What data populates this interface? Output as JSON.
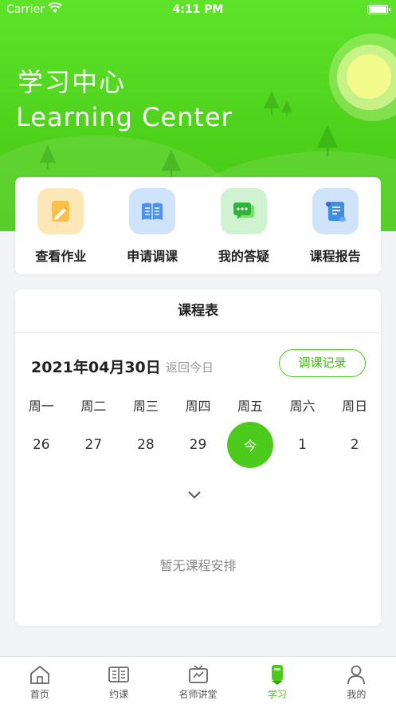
{
  "status_bar": {
    "carrier": "Carrier",
    "time": "4:11 PM"
  },
  "header": {
    "title_cn": "学习中心",
    "title_en": "Learning Center"
  },
  "quick_actions": [
    {
      "label": "查看作业",
      "icon": "pencil-icon",
      "color": "#fbb126"
    },
    {
      "label": "申请调课",
      "icon": "book-icon",
      "color": "#4a90f0"
    },
    {
      "label": "我的答疑",
      "icon": "chat-icon",
      "color": "#3cc23a"
    },
    {
      "label": "课程报告",
      "icon": "scroll-icon",
      "color": "#3f8de8"
    }
  ],
  "schedule": {
    "title": "课程表",
    "date": "2021年04月30日",
    "back_today": "返回今日",
    "record_button": "调课记录",
    "weekdays": [
      "周一",
      "周二",
      "周三",
      "周四",
      "周五",
      "周六",
      "周日"
    ],
    "days": [
      "26",
      "27",
      "28",
      "29",
      "今",
      "1",
      "2"
    ],
    "today_index": 4,
    "empty_text": "暂无课程安排"
  },
  "tabbar": [
    {
      "label": "首页",
      "icon": "home-icon"
    },
    {
      "label": "约课",
      "icon": "open-book-icon"
    },
    {
      "label": "名师讲堂",
      "icon": "tv-icon"
    },
    {
      "label": "学习",
      "icon": "study-icon",
      "active": true
    },
    {
      "label": "我的",
      "icon": "person-icon"
    }
  ],
  "colors": {
    "accent": "#4ccb1d",
    "header_green": "#52d71f"
  }
}
